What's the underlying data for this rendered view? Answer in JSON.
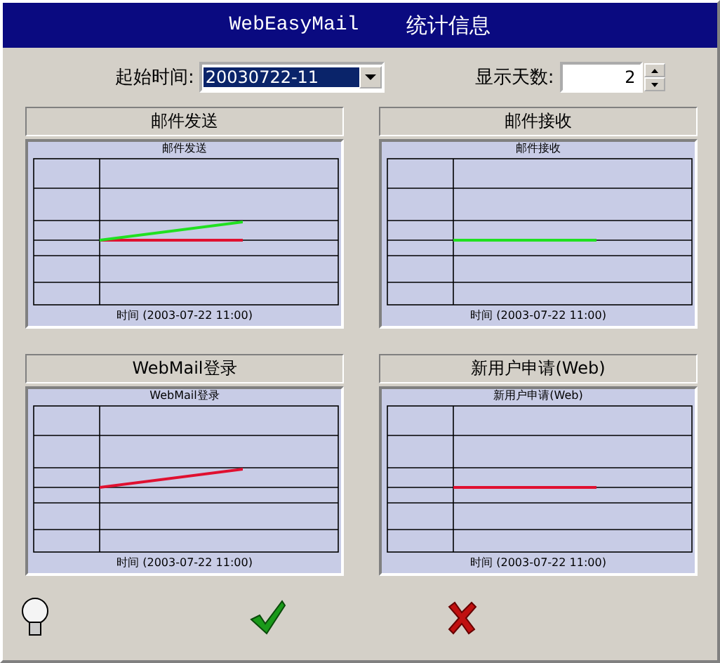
{
  "window": {
    "title_app": "WebEasyMail",
    "title": "统计信息"
  },
  "controls": {
    "start_label": "起始时间:",
    "start_value": "20030722-11",
    "days_label": "显示天数:",
    "days_value": "2"
  },
  "panels": [
    {
      "header": "邮件发送",
      "chart_title": "邮件发送",
      "x_label": "时间 (2003-07-22 11:00)",
      "series": [
        {
          "color": "#e01030",
          "kind": "flat"
        },
        {
          "color": "#20e020",
          "kind": "rising"
        }
      ]
    },
    {
      "header": "邮件接收",
      "chart_title": "邮件接收",
      "x_label": "时间 (2003-07-22 11:00)",
      "series": [
        {
          "color": "#20e020",
          "kind": "flat"
        }
      ]
    },
    {
      "header": "WebMail登录",
      "chart_title": "WebMail登录",
      "x_label": "时间 (2003-07-22 11:00)",
      "series": [
        {
          "color": "#e01030",
          "kind": "rising"
        }
      ]
    },
    {
      "header": "新用户申请(Web)",
      "chart_title": "新用户申请(Web)",
      "x_label": "时间 (2003-07-22 11:00)",
      "series": [
        {
          "color": "#e01030",
          "kind": "flat"
        }
      ]
    }
  ]
}
